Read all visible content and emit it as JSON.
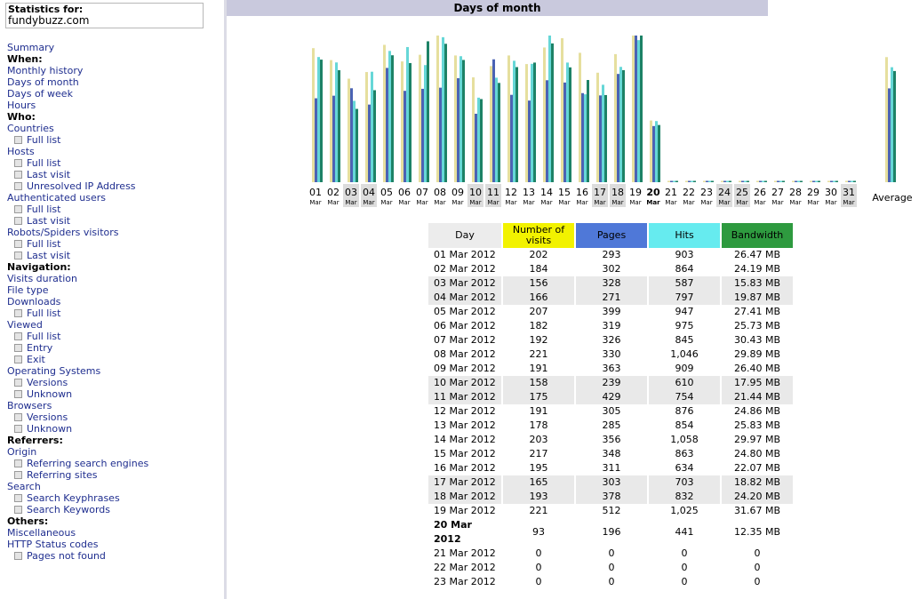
{
  "sidebar": {
    "stats_for": "Statistics for:",
    "domain": "fundybuzz.com",
    "items": [
      {
        "type": "link",
        "label": "Summary",
        "name": "nav-summary"
      },
      {
        "type": "head",
        "label": "When:",
        "name": "nav-heading-when"
      },
      {
        "type": "link",
        "label": "Monthly history",
        "name": "nav-monthly-history"
      },
      {
        "type": "link",
        "label": "Days of month",
        "name": "nav-days-of-month"
      },
      {
        "type": "link",
        "label": "Days of week",
        "name": "nav-days-of-week"
      },
      {
        "type": "link",
        "label": "Hours",
        "name": "nav-hours"
      },
      {
        "type": "head",
        "label": "Who:",
        "name": "nav-heading-who"
      },
      {
        "type": "link",
        "label": "Countries",
        "name": "nav-countries"
      },
      {
        "type": "sub",
        "label": "Full list",
        "name": "nav-countries-full-list"
      },
      {
        "type": "link",
        "label": "Hosts",
        "name": "nav-hosts"
      },
      {
        "type": "sub",
        "label": "Full list",
        "name": "nav-hosts-full-list"
      },
      {
        "type": "sub",
        "label": "Last visit",
        "name": "nav-hosts-last-visit"
      },
      {
        "type": "sub",
        "label": "Unresolved IP Address",
        "name": "nav-hosts-unresolved-ip"
      },
      {
        "type": "link",
        "label": "Authenticated users",
        "name": "nav-authenticated-users"
      },
      {
        "type": "sub",
        "label": "Full list",
        "name": "nav-auth-full-list"
      },
      {
        "type": "sub",
        "label": "Last visit",
        "name": "nav-auth-last-visit"
      },
      {
        "type": "link",
        "label": "Robots/Spiders visitors",
        "name": "nav-robots"
      },
      {
        "type": "sub",
        "label": "Full list",
        "name": "nav-robots-full-list"
      },
      {
        "type": "sub",
        "label": "Last visit",
        "name": "nav-robots-last-visit"
      },
      {
        "type": "head",
        "label": "Navigation:",
        "name": "nav-heading-navigation"
      },
      {
        "type": "link",
        "label": "Visits duration",
        "name": "nav-visits-duration"
      },
      {
        "type": "link",
        "label": "File type",
        "name": "nav-file-type"
      },
      {
        "type": "link",
        "label": "Downloads",
        "name": "nav-downloads"
      },
      {
        "type": "sub",
        "label": "Full list",
        "name": "nav-downloads-full-list"
      },
      {
        "type": "link",
        "label": "Viewed",
        "name": "nav-viewed"
      },
      {
        "type": "sub",
        "label": "Full list",
        "name": "nav-viewed-full-list"
      },
      {
        "type": "sub",
        "label": "Entry",
        "name": "nav-viewed-entry"
      },
      {
        "type": "sub",
        "label": "Exit",
        "name": "nav-viewed-exit"
      },
      {
        "type": "link",
        "label": "Operating Systems",
        "name": "nav-operating-systems"
      },
      {
        "type": "sub",
        "label": "Versions",
        "name": "nav-os-versions"
      },
      {
        "type": "sub",
        "label": "Unknown",
        "name": "nav-os-unknown"
      },
      {
        "type": "link",
        "label": "Browsers",
        "name": "nav-browsers"
      },
      {
        "type": "sub",
        "label": "Versions",
        "name": "nav-browsers-versions"
      },
      {
        "type": "sub",
        "label": "Unknown",
        "name": "nav-browsers-unknown"
      },
      {
        "type": "head",
        "label": "Referrers:",
        "name": "nav-heading-referrers"
      },
      {
        "type": "link",
        "label": "Origin",
        "name": "nav-origin"
      },
      {
        "type": "sub",
        "label": "Referring search engines",
        "name": "nav-referring-search-engines"
      },
      {
        "type": "sub",
        "label": "Referring sites",
        "name": "nav-referring-sites"
      },
      {
        "type": "link",
        "label": "Search",
        "name": "nav-search"
      },
      {
        "type": "sub",
        "label": "Search Keyphrases",
        "name": "nav-search-keyphrases"
      },
      {
        "type": "sub",
        "label": "Search Keywords",
        "name": "nav-search-keywords"
      },
      {
        "type": "head",
        "label": "Others:",
        "name": "nav-heading-others"
      },
      {
        "type": "link",
        "label": "Miscellaneous",
        "name": "nav-miscellaneous"
      },
      {
        "type": "link",
        "label": "HTTP Status codes",
        "name": "nav-http-status-codes"
      },
      {
        "type": "sub",
        "label": "Pages not found",
        "name": "nav-pages-not-found"
      }
    ]
  },
  "main": {
    "section_title": "Days of month",
    "average_label": "Average",
    "month_abbr": "Mar",
    "table_headers": {
      "day": "Day",
      "visits": "Number of visits",
      "pages": "Pages",
      "hits": "Hits",
      "bandwidth": "Bandwidth"
    }
  },
  "colors": {
    "visits": "#e6df9e",
    "pages": "#4b63b4",
    "hits": "#66d7d7",
    "bandwidth": "#1d8266",
    "title_bar": "#c9c9dd",
    "link": "#1f2e8f"
  },
  "chart_data": {
    "type": "bar",
    "categories": [
      "01",
      "02",
      "03",
      "04",
      "05",
      "06",
      "07",
      "08",
      "09",
      "10",
      "11",
      "12",
      "13",
      "14",
      "15",
      "16",
      "17",
      "18",
      "19",
      "20",
      "21",
      "22",
      "23",
      "24",
      "25",
      "26",
      "27",
      "28",
      "29",
      "30",
      "31"
    ],
    "weekend_days": [
      "03",
      "04",
      "10",
      "11",
      "17",
      "18",
      "24",
      "25",
      "31"
    ],
    "current_day": "20",
    "series": [
      {
        "name": "Number of visits",
        "values": [
          202,
          184,
          156,
          166,
          207,
          182,
          192,
          221,
          191,
          158,
          175,
          191,
          178,
          203,
          217,
          195,
          165,
          193,
          221,
          93,
          0,
          0,
          0,
          0,
          0,
          0,
          0,
          0,
          0,
          0,
          0
        ]
      },
      {
        "name": "Pages",
        "values": [
          293,
          302,
          328,
          271,
          399,
          319,
          326,
          330,
          363,
          239,
          429,
          305,
          285,
          356,
          348,
          311,
          303,
          378,
          512,
          196,
          0,
          0,
          0,
          0,
          0,
          0,
          0,
          0,
          0,
          0,
          0
        ]
      },
      {
        "name": "Hits",
        "values": [
          903,
          864,
          587,
          797,
          947,
          975,
          845,
          1046,
          909,
          610,
          754,
          876,
          854,
          1058,
          863,
          634,
          703,
          832,
          1025,
          441,
          0,
          0,
          0,
          0,
          0,
          0,
          0,
          0,
          0,
          0,
          0
        ]
      },
      {
        "name": "Bandwidth",
        "values": [
          26.47,
          24.19,
          15.83,
          19.87,
          27.41,
          25.73,
          30.43,
          29.89,
          26.4,
          17.95,
          21.44,
          24.86,
          25.83,
          29.97,
          24.8,
          22.07,
          18.82,
          24.2,
          31.67,
          12.35,
          0,
          0,
          0,
          0,
          0,
          0,
          0,
          0,
          0,
          0,
          0
        ]
      }
    ],
    "average": {
      "visits": 188.5,
      "pages": 327.6,
      "hits": 829.5,
      "bandwidth": 24.01
    }
  },
  "table": {
    "rows": [
      {
        "day": "01 Mar 2012",
        "visits": "202",
        "pages": "293",
        "hits": "903",
        "bw": "26.47 MB",
        "weekend": false,
        "today": false
      },
      {
        "day": "02 Mar 2012",
        "visits": "184",
        "pages": "302",
        "hits": "864",
        "bw": "24.19 MB",
        "weekend": false,
        "today": false
      },
      {
        "day": "03 Mar 2012",
        "visits": "156",
        "pages": "328",
        "hits": "587",
        "bw": "15.83 MB",
        "weekend": true,
        "today": false
      },
      {
        "day": "04 Mar 2012",
        "visits": "166",
        "pages": "271",
        "hits": "797",
        "bw": "19.87 MB",
        "weekend": true,
        "today": false
      },
      {
        "day": "05 Mar 2012",
        "visits": "207",
        "pages": "399",
        "hits": "947",
        "bw": "27.41 MB",
        "weekend": false,
        "today": false
      },
      {
        "day": "06 Mar 2012",
        "visits": "182",
        "pages": "319",
        "hits": "975",
        "bw": "25.73 MB",
        "weekend": false,
        "today": false
      },
      {
        "day": "07 Mar 2012",
        "visits": "192",
        "pages": "326",
        "hits": "845",
        "bw": "30.43 MB",
        "weekend": false,
        "today": false
      },
      {
        "day": "08 Mar 2012",
        "visits": "221",
        "pages": "330",
        "hits": "1,046",
        "bw": "29.89 MB",
        "weekend": false,
        "today": false
      },
      {
        "day": "09 Mar 2012",
        "visits": "191",
        "pages": "363",
        "hits": "909",
        "bw": "26.40 MB",
        "weekend": false,
        "today": false
      },
      {
        "day": "10 Mar 2012",
        "visits": "158",
        "pages": "239",
        "hits": "610",
        "bw": "17.95 MB",
        "weekend": true,
        "today": false
      },
      {
        "day": "11 Mar 2012",
        "visits": "175",
        "pages": "429",
        "hits": "754",
        "bw": "21.44 MB",
        "weekend": true,
        "today": false
      },
      {
        "day": "12 Mar 2012",
        "visits": "191",
        "pages": "305",
        "hits": "876",
        "bw": "24.86 MB",
        "weekend": false,
        "today": false
      },
      {
        "day": "13 Mar 2012",
        "visits": "178",
        "pages": "285",
        "hits": "854",
        "bw": "25.83 MB",
        "weekend": false,
        "today": false
      },
      {
        "day": "14 Mar 2012",
        "visits": "203",
        "pages": "356",
        "hits": "1,058",
        "bw": "29.97 MB",
        "weekend": false,
        "today": false
      },
      {
        "day": "15 Mar 2012",
        "visits": "217",
        "pages": "348",
        "hits": "863",
        "bw": "24.80 MB",
        "weekend": false,
        "today": false
      },
      {
        "day": "16 Mar 2012",
        "visits": "195",
        "pages": "311",
        "hits": "634",
        "bw": "22.07 MB",
        "weekend": false,
        "today": false
      },
      {
        "day": "17 Mar 2012",
        "visits": "165",
        "pages": "303",
        "hits": "703",
        "bw": "18.82 MB",
        "weekend": true,
        "today": false
      },
      {
        "day": "18 Mar 2012",
        "visits": "193",
        "pages": "378",
        "hits": "832",
        "bw": "24.20 MB",
        "weekend": true,
        "today": false
      },
      {
        "day": "19 Mar 2012",
        "visits": "221",
        "pages": "512",
        "hits": "1,025",
        "bw": "31.67 MB",
        "weekend": false,
        "today": false
      },
      {
        "day": "20 Mar 2012",
        "visits": "93",
        "pages": "196",
        "hits": "441",
        "bw": "12.35 MB",
        "weekend": false,
        "today": true
      },
      {
        "day": "21 Mar 2012",
        "visits": "0",
        "pages": "0",
        "hits": "0",
        "bw": "0",
        "weekend": false,
        "today": false
      },
      {
        "day": "22 Mar 2012",
        "visits": "0",
        "pages": "0",
        "hits": "0",
        "bw": "0",
        "weekend": false,
        "today": false
      },
      {
        "day": "23 Mar 2012",
        "visits": "0",
        "pages": "0",
        "hits": "0",
        "bw": "0",
        "weekend": false,
        "today": false
      }
    ]
  }
}
